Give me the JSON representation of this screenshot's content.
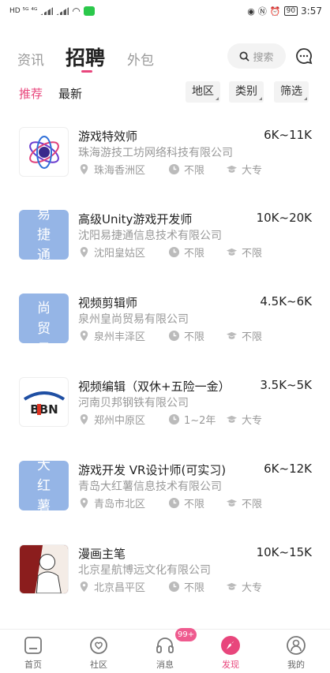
{
  "status_bar": {
    "left": "HD ⁵ᴳ ⁴ᴳ",
    "battery": "90",
    "time": "3:57"
  },
  "tabs": {
    "news": "资讯",
    "jobs": "招聘",
    "outsource": "外包"
  },
  "search": {
    "placeholder": "搜索"
  },
  "filters": {
    "recommend": "推荐",
    "latest": "最新",
    "region": "地区",
    "category": "类别",
    "filter": "筛选"
  },
  "jobs": [
    {
      "title": "游戏特效师",
      "salary": "6K~11K",
      "company": "珠海游技工坊网络科技有限公司",
      "location": "珠海香洲区",
      "experience": "不限",
      "education": "大专",
      "logo_text": ""
    },
    {
      "title": "高级Unity游戏开发师",
      "salary": "10K~20K",
      "company": "沈阳易捷通信息技术有限公司",
      "location": "沈阳皇姑区",
      "experience": "不限",
      "education": "不限",
      "logo_text": "易捷通"
    },
    {
      "title": "视频剪辑师",
      "salary": "4.5K~6K",
      "company": "泉州皇尚贸易有限公司",
      "location": "泉州丰泽区",
      "experience": "不限",
      "education": "不限",
      "logo_text": "皇尚贸易"
    },
    {
      "title": "视频编辑（双休+五险一金）",
      "salary": "3.5K~5K",
      "company": "河南贝邦钢铁有限公司",
      "location": "郑州中原区",
      "experience": "1~2年",
      "education": "大专",
      "logo_text": "BBN"
    },
    {
      "title": "游戏开发 VR设计师(可实习)",
      "salary": "6K~12K",
      "company": "青岛大红薯信息技术有限公司",
      "location": "青岛市北区",
      "experience": "不限",
      "education": "不限",
      "logo_text": "大红薯"
    },
    {
      "title": "漫画主笔",
      "salary": "10K~15K",
      "company": "北京星航博远文化有限公司",
      "location": "北京昌平区",
      "experience": "不限",
      "education": "大专",
      "logo_text": ""
    }
  ],
  "bottom_nav": {
    "home": "首页",
    "community": "社区",
    "messages": "消息",
    "messages_badge": "99+",
    "discover": "发现",
    "mine": "我的"
  },
  "colors": {
    "accent": "#e8467c",
    "logo_blue": "#95b5e6"
  }
}
